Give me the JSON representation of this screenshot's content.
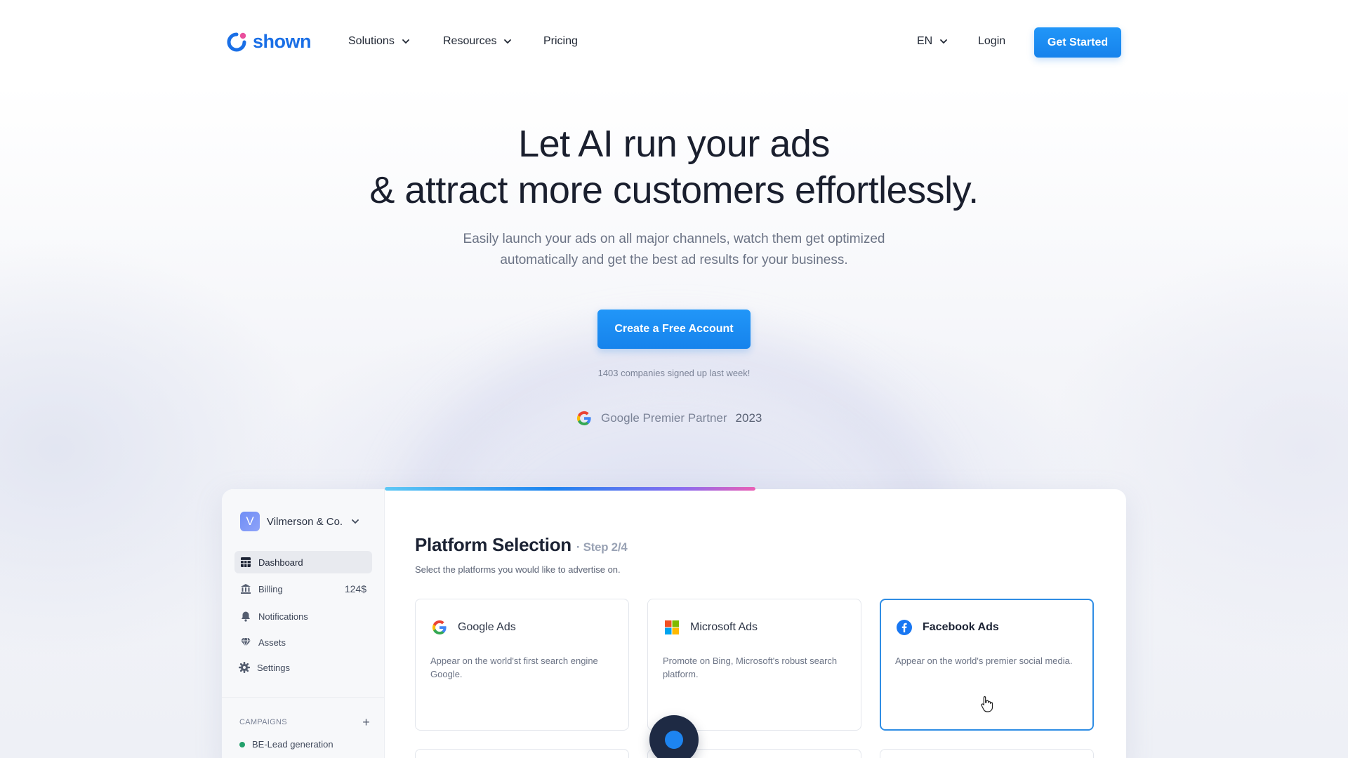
{
  "brand": {
    "name": "shown",
    "color": "#1a6fe6"
  },
  "nav": {
    "items": [
      {
        "label": "Solutions",
        "has_dropdown": true
      },
      {
        "label": "Resources",
        "has_dropdown": true
      },
      {
        "label": "Pricing",
        "has_dropdown": false
      }
    ],
    "language": "EN",
    "login_label": "Login",
    "cta_label": "Get Started"
  },
  "hero": {
    "title_line1": "Let AI run your ads",
    "title_line2": "& attract more customers effortlessly.",
    "subtitle_line1": "Easily launch your ads on all major channels, watch them get optimized",
    "subtitle_line2": "automatically and get the best ad results for your business.",
    "cta_label": "Create a Free Account",
    "signup_note": "1403 companies signed up last week!",
    "partner_label": "Google Premier Partner",
    "partner_year": "2023"
  },
  "app": {
    "org_initial": "V",
    "org_name": "Vilmerson & Co.",
    "sidebar": [
      {
        "label": "Dashboard",
        "icon": "dashboard-icon",
        "value": "",
        "active": true
      },
      {
        "label": "Billing",
        "icon": "bank-icon",
        "value": "124$",
        "active": false
      },
      {
        "label": "Notifications",
        "icon": "bell-icon",
        "value": "",
        "active": false
      },
      {
        "label": "Assets",
        "icon": "gem-icon",
        "value": "",
        "active": false
      },
      {
        "label": "Settings",
        "icon": "gear-icon",
        "value": "",
        "active": false
      }
    ],
    "campaigns_heading": "CAMPAIGNS",
    "campaigns_add": "+",
    "campaigns": [
      {
        "label": "BE-Lead generation",
        "status_color": "#22a06b"
      }
    ],
    "progress_fraction": 0.5,
    "main": {
      "title": "Platform Selection",
      "step": "· Step 2/4",
      "description": "Select the platforms you would like to advertise on.",
      "platforms": [
        {
          "name": "Google Ads",
          "description": "Appear on the world'st first search engine Google.",
          "selected": false,
          "icon": "google-icon"
        },
        {
          "name": "Microsoft Ads",
          "description": "Promote on Bing, Microsoft's robust search platform.",
          "selected": false,
          "icon": "microsoft-icon"
        },
        {
          "name": "Facebook Ads",
          "description": "Appear on the world's premier social media.",
          "selected": true,
          "icon": "facebook-icon"
        }
      ]
    }
  },
  "colors": {
    "primary": "#1d8cf0",
    "text_dark": "#1a1f2e",
    "text_muted": "#6b7385",
    "selected_border": "#2f8de4",
    "progress_gradient": [
      "#5ec8f5",
      "#1d84f0",
      "#8a6cf0",
      "#ea5fb5"
    ]
  }
}
